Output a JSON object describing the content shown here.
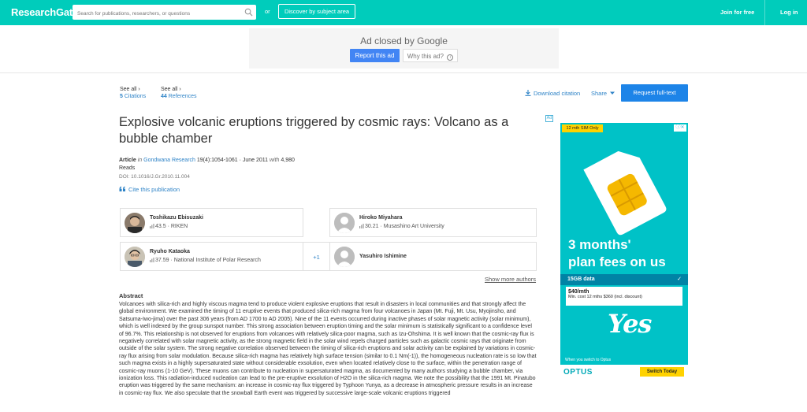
{
  "header": {
    "logo": "ResearchGate",
    "search_placeholder": "Search for publications, researchers, or questions",
    "or_text": "or",
    "discover_label": "Discover by subject area",
    "join_label": "Join for free",
    "login_label": "Log in"
  },
  "ad_banner": {
    "closed_prefix": "Ad closed by",
    "closed_brand": "Google",
    "report_label": "Report this ad",
    "why_label": "Why this ad?",
    "info_glyph": "i"
  },
  "stats": {
    "citations_see": "See all ›",
    "citations_count": "5",
    "citations_label": " Citations",
    "references_see": "See all ›",
    "references_count": "44",
    "references_label": " References"
  },
  "actions": {
    "download_citation": "Download citation",
    "share": "Share",
    "request_fulltext": "Request full-text"
  },
  "publication": {
    "title": "Explosive volcanic eruptions triggered by cosmic rays: Volcano as a bubble chamber",
    "type": "Article",
    "in_label": "in",
    "journal": "Gondwana Research",
    "volume_date": " 19(4):1054-1061 · June 2011 ",
    "with_label": "with",
    "reads_count": " 4,980",
    "reads_label": "Reads",
    "doi": "DOI: 10.1016/J.Gr.2010.11.004",
    "cite_label": "Cite this publication"
  },
  "authors": [
    {
      "name": "Toshikazu Ebisuzaki",
      "score": "43.5",
      "affiliation": " · RIKEN"
    },
    {
      "name": "Hiroko Miyahara",
      "score": "30.21",
      "affiliation": " · Musashino Art University"
    },
    {
      "name": "Ryuho Kataoka",
      "score": "37.59",
      "affiliation": " · National Institute of Polar Research"
    },
    {
      "name": "Yasuhiro Ishimine",
      "score": "",
      "affiliation": ""
    }
  ],
  "more_authors": "+1",
  "show_more_authors": "Show more authors",
  "abstract": {
    "heading": "Abstract",
    "text": "Volcanoes with silica-rich and highly viscous magma tend to produce violent explosive eruptions that result in disasters in local communities and that strongly affect the global environment. We examined the timing of 11 eruptive events that produced silica-rich magma from four volcanoes in Japan (Mt. Fuji, Mt. Usu, Myojinsho, and Satsuma-Iwo-jima) over the past 306 years (from AD 1700 to AD 2005). Nine of the 11 events occurred during inactive phases of solar magnetic activity (solar minimum), which is well indexed by the group sunspot number. This strong association between eruption timing and the solar minimum is statistically significant to a confidence level of 96.7%. This relationship is not observed for eruptions from volcanoes with relatively silica-poor magma, such as Izu-Ohshima. It is well known that the cosmic-ray flux is negatively correlated with solar magnetic activity, as the strong magnetic field in the solar wind repels charged particles such as galactic cosmic rays that originate from outside of the solar system. The strong negative correlation observed between the timing of silica-rich eruptions and solar activity can be explained by variations in cosmic-ray flux arising from solar modulation. Because silica-rich magma has relatively high surface tension (similar to 0.1 Nm(-1)), the homogeneous nucleation rate is so low that such magma exists in a highly supersaturated state without considerable exsolution, even when located relatively close to the surface, within the penetration range of cosmic-ray muons (1-10 GeV). These muons can contribute to nucleation in supersaturated magma, as documented by many authors studying a bubble chamber, via ionization loss. This radiation-induced nucleation can lead to the pre-eruptive exsolution of H2O in the silica-rich magma. We note the possibility that the 1991 Mt. Pinatubo eruption was triggered by the same mechanism: an increase in cosmic-ray flux triggered by Typhoon Yunya, as a decrease in atmospheric pressure results in an increase in cosmic-ray flux. We also speculate that the snowball Earth event was triggered by successive large-scale volcanic eruptions triggered"
  },
  "side_ad": {
    "ad_label": "Ad",
    "sim_tag": "12 mth SIM Only",
    "close_label": "ⓘ✕",
    "headline_1": "3 months'",
    "headline_2": "plan fees on us",
    "data": "15GB data",
    "check": "✓",
    "price": "$40/mth",
    "price_sub": "Min. cost 12 mths $360 (incl. discount)",
    "yes": "Yes",
    "switch_small": "When you switch to Optus",
    "brand": "OPTUS",
    "switch_cta": "Switch Today"
  },
  "colors": {
    "brand_teal": "#00ccbb",
    "link_blue": "#2e83c7",
    "button_blue": "#1d84e8"
  }
}
